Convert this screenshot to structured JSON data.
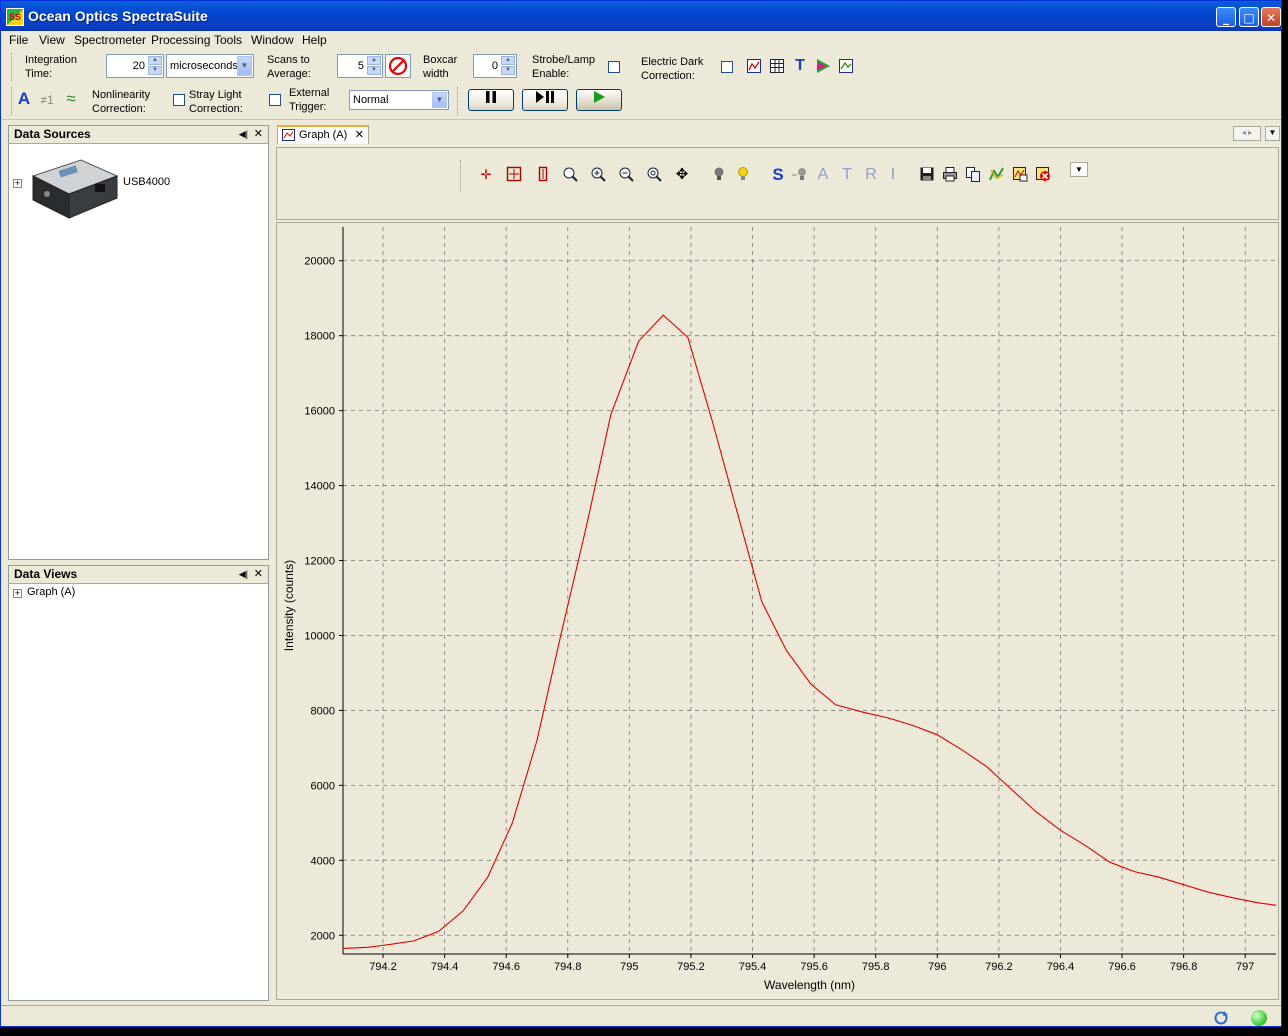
{
  "window": {
    "title": "Ocean Optics SpectraSuite",
    "app_icon_text": "SS"
  },
  "menu": [
    "File",
    "View",
    "Spectrometer",
    "Processing",
    "Tools",
    "Window",
    "Help"
  ],
  "toolbar": {
    "integration_time_label": [
      "Integration",
      "Time:"
    ],
    "integration_time_value": "20",
    "integration_unit": "microseconds",
    "scans_label": [
      "Scans to",
      "Average:"
    ],
    "scans_value": "5",
    "boxcar_label": [
      "Boxcar",
      "width"
    ],
    "boxcar_value": "0",
    "strobe_label": [
      "Strobe/Lamp",
      "Enable:"
    ],
    "electric_dark_label": [
      "Electric Dark",
      "Correction:"
    ],
    "nonlinearity_label": [
      "Nonlinearity",
      "Correction:"
    ],
    "stray_light_label": [
      "Stray Light",
      "Correction:"
    ],
    "external_trigger_label": [
      "External",
      "Trigger:"
    ],
    "trigger_mode": "Normal",
    "neq_glyph": "≠1"
  },
  "data_sources": {
    "title": "Data Sources",
    "items": [
      "USB4000"
    ]
  },
  "data_views": {
    "title": "Data Views",
    "items": [
      "Graph (A)"
    ]
  },
  "editor_tab": {
    "label": "Graph (A)"
  },
  "graph_toolbar": {
    "letter_buttons": [
      "S",
      "A",
      "T",
      "R",
      "I"
    ]
  },
  "colors": {
    "curve": "#e00000",
    "grid": "#7a7a7a",
    "titlebar": "#0a5fd8"
  },
  "chart_data": {
    "type": "line",
    "xlabel": "Wavelength (nm)",
    "ylabel": "Intensity (counts)",
    "xlim": [
      794.07,
      797.1
    ],
    "ylim": [
      1500,
      20900
    ],
    "grid": true,
    "x_ticks": [
      794.2,
      794.4,
      794.6,
      794.8,
      795,
      795.2,
      795.4,
      795.6,
      795.8,
      796,
      796.2,
      796.4,
      796.6,
      796.8,
      797
    ],
    "x_tick_labels": [
      "794.2",
      "794.4",
      "794.6",
      "794.8",
      "795",
      "795.2",
      "795.4",
      "795.6",
      "795.8",
      "796",
      "796.2",
      "796.4",
      "796.6",
      "796.8",
      "797"
    ],
    "y_ticks": [
      2000,
      4000,
      6000,
      8000,
      10000,
      12000,
      14000,
      16000,
      18000,
      20000
    ],
    "y_tick_labels": [
      "2000",
      "4000",
      "6000",
      "8000",
      "10000",
      "12000",
      "14000",
      "16000",
      "18000",
      "20000"
    ],
    "series": [
      {
        "x": [
          794.07,
          794.15,
          794.22,
          794.3,
          794.38,
          794.46,
          794.54,
          794.62,
          794.7,
          794.78,
          794.86,
          794.94,
          795.03,
          795.11,
          795.19,
          795.27,
          795.35,
          795.43,
          795.51,
          795.59,
          795.67,
          795.76,
          795.84,
          795.92,
          796.0,
          796.08,
          796.16,
          796.24,
          796.32,
          796.4,
          796.48,
          796.56,
          796.64,
          796.72,
          796.8,
          796.88,
          796.96,
          797.04,
          797.1
        ],
        "y": [
          1650,
          1680,
          1750,
          1850,
          2100,
          2650,
          3550,
          5000,
          7200,
          10100,
          12900,
          15900,
          17850,
          18550,
          17950,
          15700,
          13300,
          10900,
          9600,
          8700,
          8150,
          7950,
          7800,
          7600,
          7350,
          6950,
          6500,
          5900,
          5300,
          4800,
          4400,
          3950,
          3700,
          3550,
          3350,
          3150,
          3000,
          2870,
          2800
        ]
      }
    ]
  }
}
